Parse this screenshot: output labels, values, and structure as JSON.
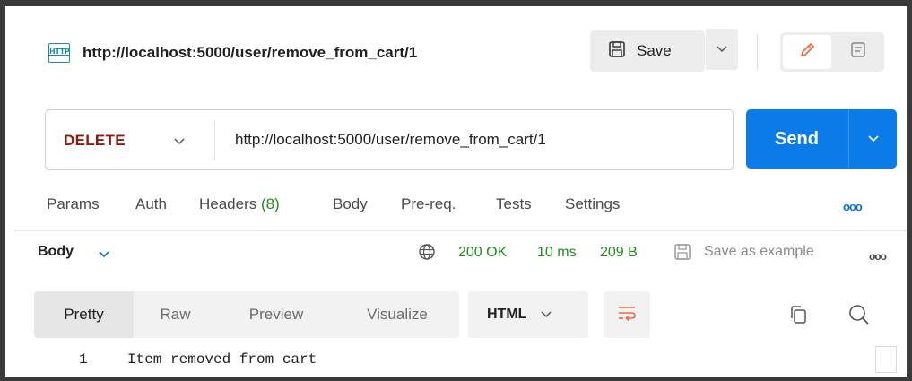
{
  "request": {
    "title": "http://localhost:5000/user/remove_from_cart/1",
    "icon": "http-icon",
    "icon_text": "HTTP",
    "method": "DELETE",
    "url": "http://localhost:5000/user/remove_from_cart/1"
  },
  "toolbar": {
    "save_label": "Save",
    "send_label": "Send"
  },
  "request_tabs": [
    {
      "label": "Params"
    },
    {
      "label": "Auth"
    },
    {
      "label": "Headers",
      "count": "(8)"
    },
    {
      "label": "Body"
    },
    {
      "label": "Pre-req."
    },
    {
      "label": "Tests"
    },
    {
      "label": "Settings"
    }
  ],
  "more_dots": "ooo",
  "response": {
    "section_label": "Body",
    "status": "200 OK",
    "time": "10 ms",
    "size": "209 B",
    "save_example_label": "Save as example",
    "view_tabs": [
      "Pretty",
      "Raw",
      "Preview",
      "Visualize"
    ],
    "active_view": "Pretty",
    "format": "HTML",
    "lines": [
      {
        "number": "1",
        "text": "Item removed from cart"
      }
    ]
  },
  "colors": {
    "accent": "#0b7be8",
    "method": "#8e1a10",
    "success": "#1f8c1f"
  }
}
